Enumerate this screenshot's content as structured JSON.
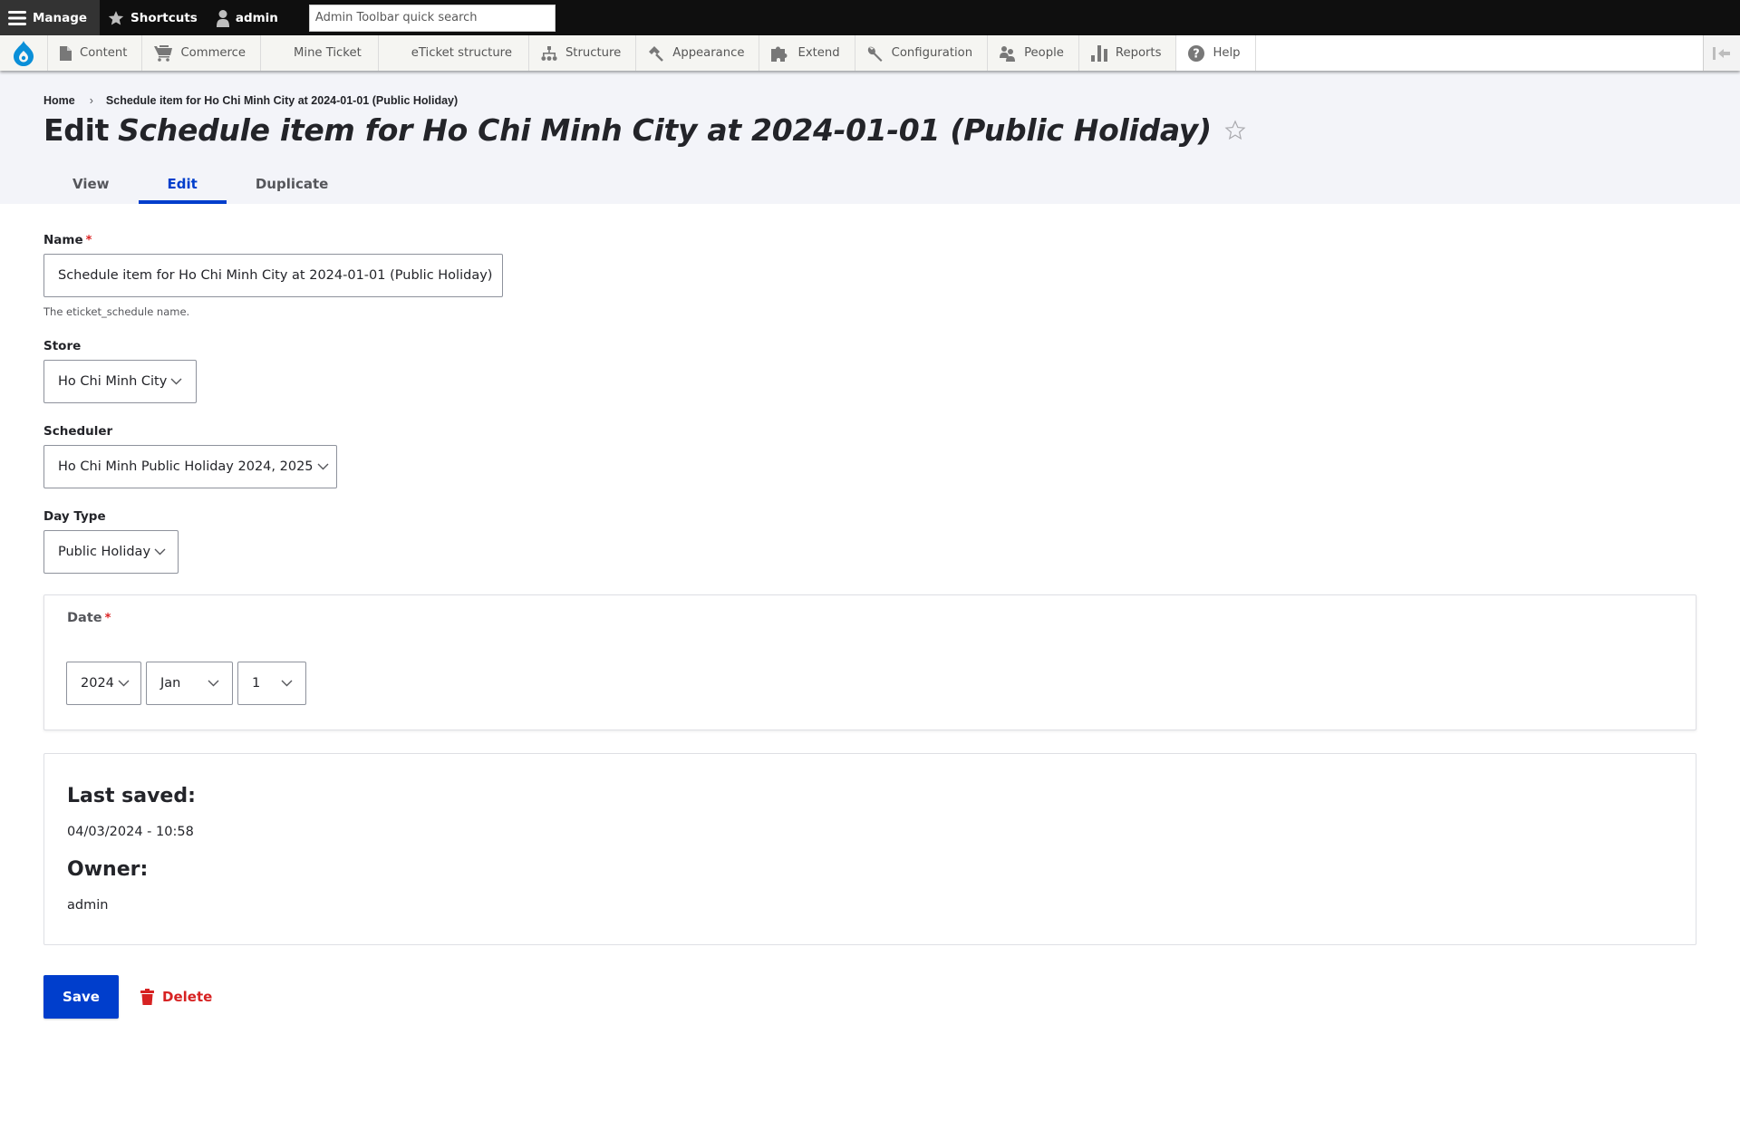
{
  "toolbar": {
    "manage_label": "Manage",
    "shortcuts_label": "Shortcuts",
    "user_label": "admin",
    "search_placeholder": "Admin Toolbar quick search",
    "search_value": ""
  },
  "tray": {
    "items": [
      {
        "label": "Content",
        "icon": "file-icon"
      },
      {
        "label": "Commerce",
        "icon": "shopping-cart-icon"
      },
      {
        "label": "Mine Ticket",
        "icon": null
      },
      {
        "label": "eTicket structure",
        "icon": null
      },
      {
        "label": "Structure",
        "icon": "sitemap-icon"
      },
      {
        "label": "Appearance",
        "icon": "paintbrush-icon"
      },
      {
        "label": "Extend",
        "icon": "puzzle-icon"
      },
      {
        "label": "Configuration",
        "icon": "wrench-icon"
      },
      {
        "label": "People",
        "icon": "people-icon"
      },
      {
        "label": "Reports",
        "icon": "bar-chart-icon"
      },
      {
        "label": "Help",
        "icon": "help-icon"
      }
    ]
  },
  "breadcrumb": {
    "home": "Home",
    "separator": "›",
    "current": "Schedule item for Ho Chi Minh City at 2024-01-01 (Public Holiday)"
  },
  "page": {
    "title_prefix": "Edit",
    "title_entity": "Schedule item for Ho Chi Minh City at 2024-01-01 (Public Holiday)"
  },
  "tabs": [
    {
      "label": "View",
      "active": false
    },
    {
      "label": "Edit",
      "active": true
    },
    {
      "label": "Duplicate",
      "active": false
    }
  ],
  "form": {
    "name": {
      "label": "Name",
      "required": "*",
      "value": "Schedule item for Ho Chi Minh City at 2024-01-01 (Public Holiday)",
      "description": "The eticket_schedule name."
    },
    "store": {
      "label": "Store",
      "selected": "Ho Chi Minh City"
    },
    "scheduler": {
      "label": "Scheduler",
      "selected": "Ho Chi Minh Public Holiday 2024, 2025"
    },
    "day_type": {
      "label": "Day Type",
      "selected": "Public Holiday"
    },
    "date": {
      "label": "Date",
      "required": "*",
      "year": "2024",
      "month": "Jan",
      "day": "1"
    }
  },
  "meta": {
    "last_saved_label": "Last saved:",
    "last_saved_value": "04/03/2024 - 10:58",
    "owner_label": "Owner:",
    "owner_value": "admin"
  },
  "actions": {
    "save_label": "Save",
    "delete_label": "Delete"
  },
  "colors": {
    "accent": "#003ecc",
    "danger": "#d72222",
    "toolbar_bg": "#0f0f0f",
    "header_bg": "#f3f4f9"
  }
}
